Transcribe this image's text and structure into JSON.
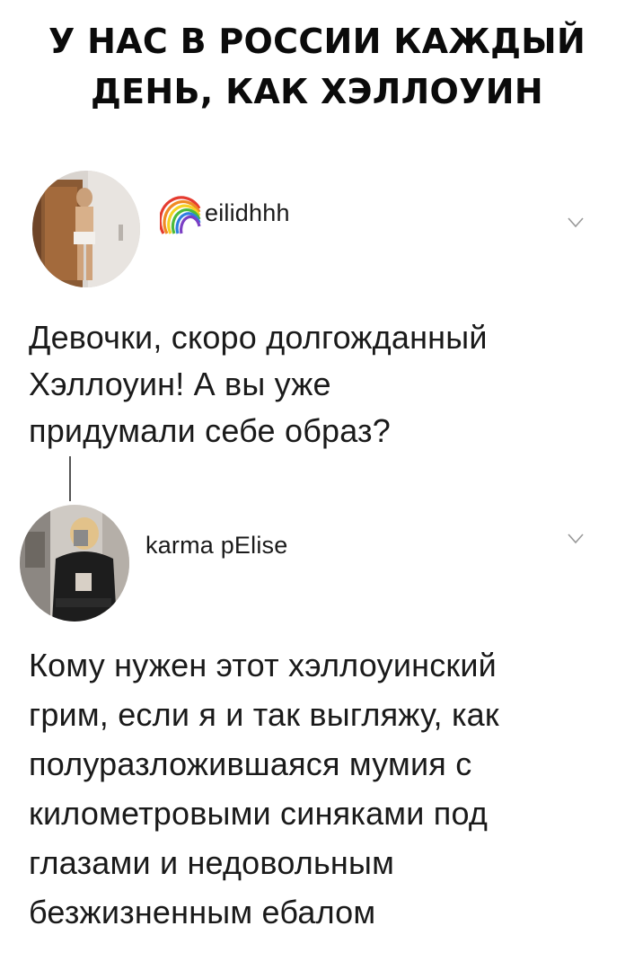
{
  "meme": {
    "title_lines": [
      "У НАС В РОССИИ КАЖДЫЙ",
      "ДЕНЬ, КАК ХЭЛЛОУИН"
    ]
  },
  "posts": [
    {
      "username": "eilidhhh",
      "text_lines": [
        "Девочки, скоро долгожданный",
        "Хэллоуин! А вы уже",
        "придумали себе образ?"
      ]
    },
    {
      "username": "karma pElise",
      "text_lines": [
        "Кому нужен этот хэллоуинский",
        "грим, если я и так выгляжу, как",
        "полуразложившаяся мумия с",
        "километровыми синяками под",
        "глазами и недовольным",
        "безжизненным ебалом"
      ]
    }
  ],
  "icons": {
    "rainbow": "rainbow-icon",
    "chevron": "chevron-down-icon"
  },
  "colors": {
    "text": "#111111",
    "chevron": "#9a9a9a",
    "thread_line": "#555555"
  }
}
